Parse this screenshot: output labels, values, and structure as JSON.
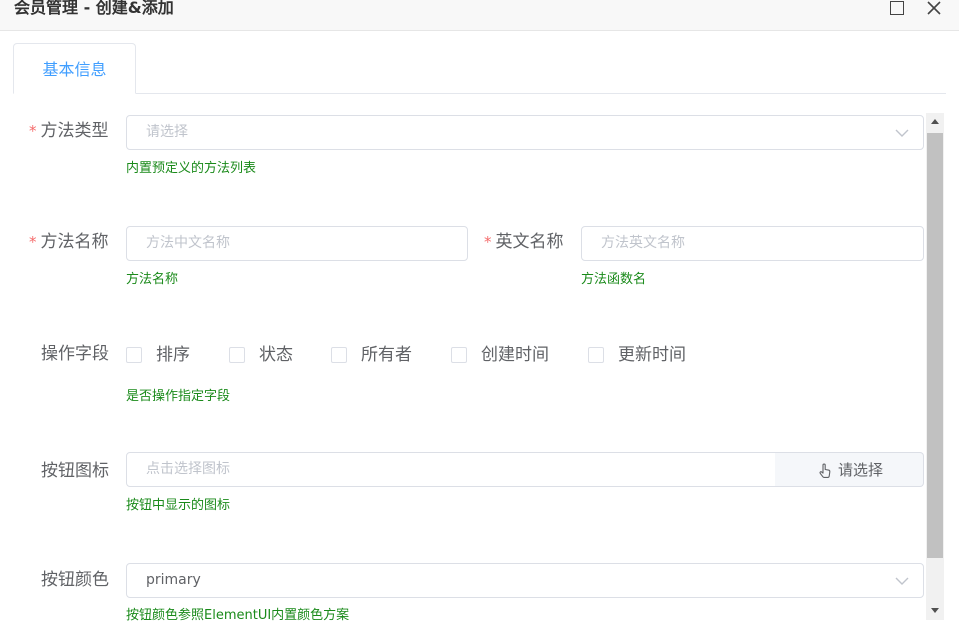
{
  "window": {
    "title": "会员管理 - 创建&添加",
    "maximize_icon": "maximize-icon",
    "close_icon": "close-icon"
  },
  "tabs": [
    {
      "label": "基本信息",
      "active": true
    }
  ],
  "form": {
    "required_mark": "*",
    "method_type": {
      "label": "方法类型",
      "placeholder": "请选择",
      "hint": "内置预定义的方法列表"
    },
    "method_name": {
      "label": "方法名称",
      "placeholder": "方法中文名称",
      "hint": "方法名称"
    },
    "english_name": {
      "label": "英文名称",
      "placeholder": "方法英文名称",
      "hint": "方法函数名"
    },
    "operation_fields": {
      "label": "操作字段",
      "options": [
        "排序",
        "状态",
        "所有者",
        "创建时间",
        "更新时间"
      ],
      "hint": "是否操作指定字段"
    },
    "button_icon": {
      "label": "按钮图标",
      "placeholder": "点击选择图标",
      "append_label": "请选择",
      "append_icon": "hand-pointer-icon",
      "hint": "按钮中显示的图标"
    },
    "button_color": {
      "label": "按钮颜色",
      "value": "primary",
      "hint": "按钮颜色参照ElementUI内置颜色方案"
    }
  },
  "colors": {
    "accent": "#409eff",
    "required": "#f56c6c",
    "hint": "#1a8a1a",
    "border": "#dcdfe6"
  }
}
